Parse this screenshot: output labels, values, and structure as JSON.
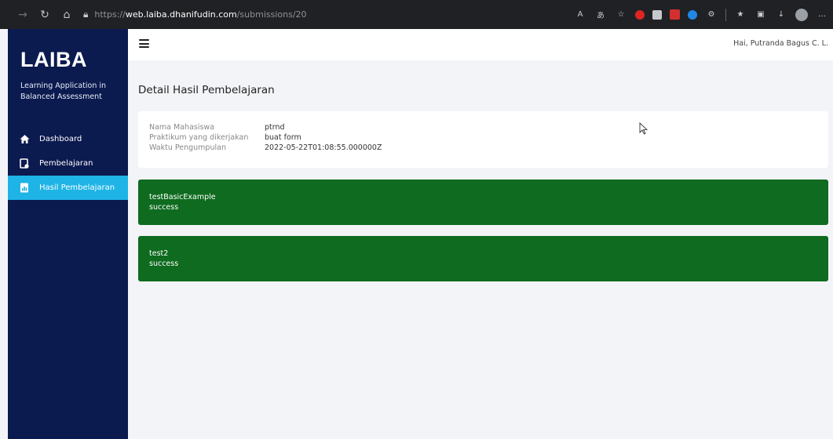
{
  "browser": {
    "url_scheme": "https://",
    "url_host": "web.laiba.dhanifudin.com",
    "url_path": "/submissions/20"
  },
  "sidebar": {
    "brand": "LAIBA",
    "tagline": "Learning Application in Balanced Assessment",
    "items": [
      {
        "label": "Dashboard",
        "icon": "home-icon"
      },
      {
        "label": "Pembelajaran",
        "icon": "document-icon"
      },
      {
        "label": "Hasil Pembelajaran",
        "icon": "report-icon",
        "active": true
      }
    ],
    "colors": {
      "background": "#0b1a4f",
      "active": "#1eb4e6"
    }
  },
  "header": {
    "greeting": "Hai, Putranda Bagus C. L."
  },
  "main": {
    "title": "Detail Hasil Pembelajaran",
    "info": [
      {
        "label": "Nama Mahasiswa",
        "value": "ptrnd"
      },
      {
        "label": "Praktikum yang dikerjakan",
        "value": "buat form"
      },
      {
        "label": "Waktu Pengumpulan",
        "value": "2022-05-22T01:08:55.000000Z"
      }
    ],
    "results": [
      {
        "name": "testBasicExample",
        "status": "success"
      },
      {
        "name": "test2",
        "status": "success"
      }
    ],
    "colors": {
      "success": "#0e6b1f"
    }
  }
}
